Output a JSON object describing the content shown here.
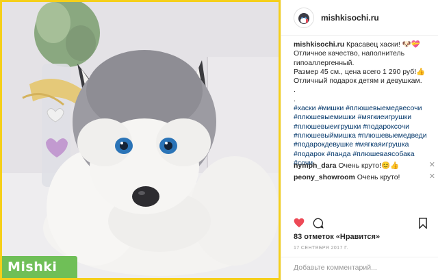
{
  "post": {
    "username": "mishkisochi.ru",
    "watermark": "Mishki #1",
    "caption": {
      "username": "mishkisochi.ru",
      "lines": [
        " Красавец хаски! 🐶💝",
        "Отличное качество, наполнитель",
        "гипоаллергенный.",
        "Размер 45 см., цена всего 1 290 руб!👍",
        "Отличный подарок детям и девушкам.",
        ".",
        "."
      ],
      "hashtag_lines": [
        "#хаски #мишки #плюшевыемедвесочи",
        "#плюшевыемишки #мягкиеигрушки",
        "#плюшевыеигрушки #подарoксочи",
        "#плюшевыймишка #плюшевыемедведи",
        "#подарокдевушке #мягкаяигрушка",
        "#подарок #панда #плюшеваясобака",
        "#сочи"
      ]
    },
    "comments": [
      {
        "username": "nymph_dara",
        "text": " Очень круто!😊👍"
      },
      {
        "username": "peony_showroom",
        "text": " Очень круто!"
      }
    ],
    "likes": "83 отметок «Нравится»",
    "date": "17 СЕНТЯБРЯ 2017 Г.",
    "add_comment_placeholder": "Добавьте комментарий...",
    "icons": {
      "avatar": "husky-avatar-icon",
      "like": "heart-filled-icon",
      "comment": "speech-bubble-icon",
      "save": "bookmark-icon",
      "remove": "close-icon"
    },
    "colors": {
      "frame": "#f5cf1a",
      "watermark_bg": "#6fbf57",
      "heart": "#ed4956",
      "hashtag": "#003569"
    }
  }
}
